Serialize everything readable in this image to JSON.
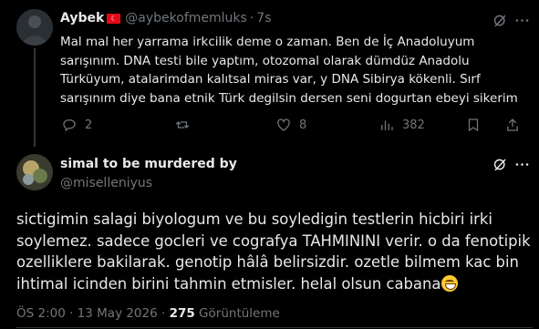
{
  "parent_tweet": {
    "display_name": "Aybek",
    "flag": "☾",
    "handle": "@aybekofmemluks",
    "separator": "·",
    "time": "7s",
    "text": "Mal mal her yarrama irkcilik deme o zaman. Ben de İç Anadoluyum\nsarışınım. DNA testi bile yaptım, otozomal olarak dümdüz Anadolu\nTürküyum, atalarimdan kalıtsal miras var, y DNA Sibirya kökenli. Sırf\nsarışınım diye bana etnik Türk degilsin dersen seni dogurtan ebeyi sikerim",
    "actions": {
      "reply_count": "2",
      "repost_count": "",
      "like_count": "8",
      "view_count": "382"
    }
  },
  "main_tweet": {
    "display_name": "simal to be murdered by",
    "handle": "@miselleniyus",
    "text": "sictigimin salagi biyologum ve bu soyledigin testlerin hicbiri irki\nsoylemez. sadece gocleri ve cografya TAHMININI verir. o da fenotipik\nozelliklere bakilarak. genotip hâlâ belirsizdir. ozetle bilmem kac bin\nihtimal icinden birini tahmin etmisler. helal olsun cabana",
    "emoji": "grinning-face-with-smiling-eyes",
    "timestamp": "ÖS 2:00 · 13 May 2026 · ",
    "views": "275",
    "views_label": " Görüntüleme"
  },
  "colors": {
    "background": "#000000",
    "text": "#e7e9ea",
    "muted": "#71767b",
    "divider": "#2f3336"
  }
}
